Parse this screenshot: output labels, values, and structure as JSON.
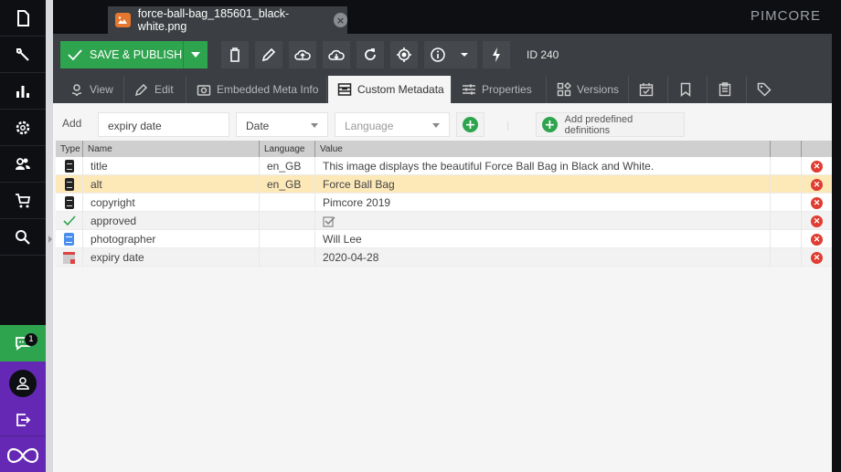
{
  "app": {
    "brand": "PIMCORE"
  },
  "sidebar": {
    "items": [
      {
        "icon": "document-icon",
        "label": "Documents"
      },
      {
        "icon": "wrench-icon",
        "label": "Tools"
      },
      {
        "icon": "chart-icon",
        "label": "Marketing"
      },
      {
        "icon": "gear-icon",
        "label": "Settings"
      },
      {
        "icon": "users-icon",
        "label": "Users"
      },
      {
        "icon": "cart-icon",
        "label": "E-Commerce"
      },
      {
        "icon": "search-icon",
        "label": "Search"
      }
    ],
    "notifications_count": "1"
  },
  "tab": {
    "title": "force-ball-bag_185601_black-white.png",
    "close": "×"
  },
  "toolbar": {
    "save_label": "SAVE & PUBLISH",
    "id_label": "ID 240",
    "buttons": [
      "delete",
      "rename",
      "upload",
      "download",
      "reload",
      "locate",
      "info",
      "more",
      "clear-thumbnails"
    ]
  },
  "editor_tabs": [
    {
      "label": "View",
      "icon": "flower-icon",
      "active": false
    },
    {
      "label": "Edit",
      "icon": "pencil-icon",
      "active": false
    },
    {
      "label": "Embedded Meta Info",
      "icon": "camera-icon",
      "active": false
    },
    {
      "label": "Custom Metadata",
      "icon": "metadata-icon",
      "active": true
    },
    {
      "label": "Properties",
      "icon": "sliders-icon",
      "active": false
    },
    {
      "label": "Versions",
      "icon": "versions-icon",
      "active": false
    },
    {
      "label": "",
      "icon": "calendar-check-icon",
      "active": false
    },
    {
      "label": "",
      "icon": "bookmark-icon",
      "active": false
    },
    {
      "label": "",
      "icon": "clipboard-icon",
      "active": false
    },
    {
      "label": "",
      "icon": "tag-icon",
      "active": false
    }
  ],
  "add_row": {
    "label": "Add",
    "name_value": "expiry date",
    "type_value": "Date",
    "language_placeholder": "Language",
    "predefined_label": "Add predefined definitions"
  },
  "grid": {
    "columns": [
      "Type",
      "Name",
      "Language",
      "Value",
      "",
      ""
    ],
    "rows": [
      {
        "type": "input",
        "name": "title",
        "language": "en_GB",
        "value": "This image displays the beautiful Force Ball Bag in Black and White."
      },
      {
        "type": "input",
        "name": "alt",
        "language": "en_GB",
        "value": "Force Ball Bag",
        "selected": true
      },
      {
        "type": "input",
        "name": "copyright",
        "language": "",
        "value": "Pimcore 2019"
      },
      {
        "type": "checkbox",
        "name": "approved",
        "language": "",
        "value": "checked"
      },
      {
        "type": "textarea",
        "name": "photographer",
        "language": "",
        "value": "Will Lee"
      },
      {
        "type": "date",
        "name": "expiry date",
        "language": "",
        "value": "2020-04-28"
      }
    ]
  },
  "colors": {
    "accent": "#2ea44f",
    "purple": "#6428b4",
    "danger": "#e03c31",
    "selected_row": "#fde8b8"
  }
}
